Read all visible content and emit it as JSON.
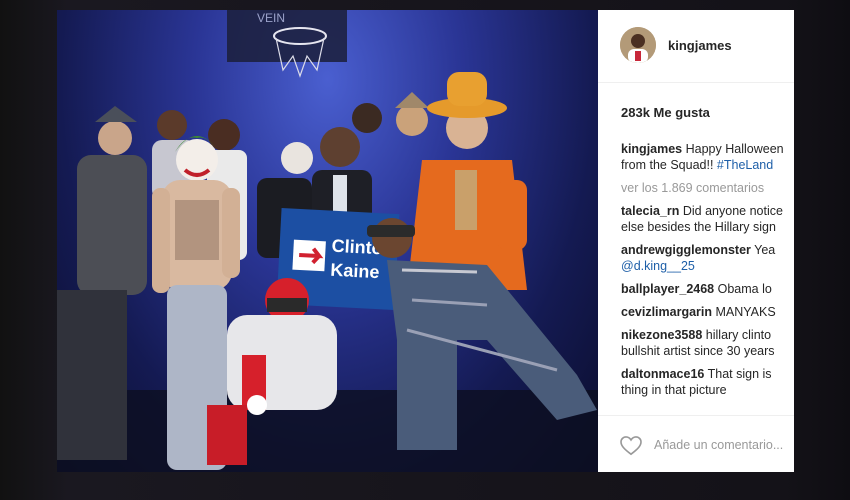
{
  "post": {
    "username": "kingjames",
    "likes": "283k Me gusta",
    "sign_text": [
      "Clinton",
      "Kaine"
    ],
    "caption": {
      "user": "kingjames",
      "line1": "Happy Halloween",
      "line2": "from the Squad!!",
      "hashtag": "#TheLand"
    },
    "view_comments": "ver los 1.869 comentarios",
    "comments": [
      {
        "user": "talecia_rn",
        "text": "Did anyone notice",
        "cont": "else besides the Hillary sign"
      },
      {
        "user": "andrewgigglemonster",
        "text": "Yea",
        "cont": "@d.king__25"
      },
      {
        "user": "ballplayer_2468",
        "text": "Obama lo",
        "cont": ""
      },
      {
        "user": "cevizlimargarin",
        "text": "MANYAKS",
        "cont": ""
      },
      {
        "user": "nikezone3588",
        "text": "hillary clinto",
        "cont": "bullshit artist since 30 years"
      },
      {
        "user": "daltonmace16",
        "text": "That sign is",
        "cont": "thing in that picture"
      }
    ],
    "add_comment_placeholder": "Añade un comentario...",
    "icons": {
      "heart": "heart-icon",
      "avatar": "avatar"
    }
  },
  "colors": {
    "photo_bg": "#2a3595",
    "link": "#1e5fa8",
    "muted": "#999999",
    "text": "#262626",
    "sign_blue": "#1c4fa3"
  }
}
